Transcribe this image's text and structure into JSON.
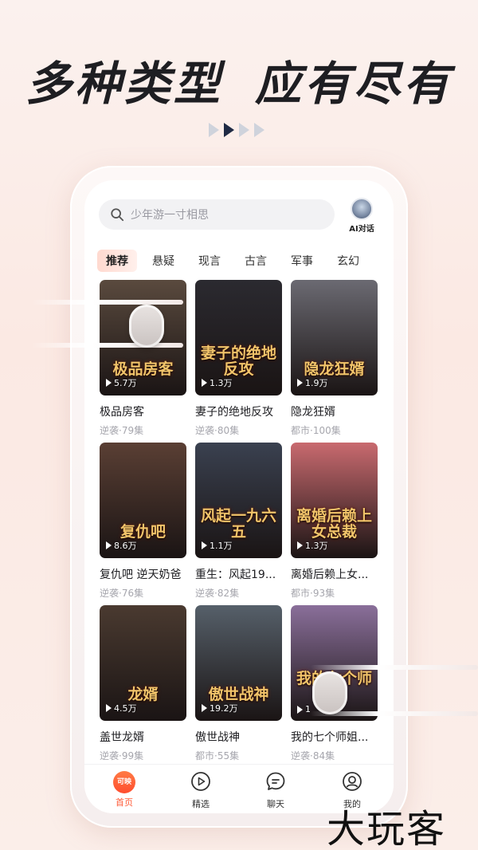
{
  "headline": {
    "left": "多种类型",
    "right": "应有尽有"
  },
  "search": {
    "placeholder": "少年游一寸相思"
  },
  "ai_button": {
    "label": "AI对话"
  },
  "tabs": [
    "推荐",
    "悬疑",
    "现言",
    "古言",
    "军事",
    "玄幻"
  ],
  "cards": [
    {
      "name": "极品房客",
      "meta": "逆袭·79集",
      "views": "5.7万",
      "poster_text": "极品房客",
      "bg": "#5a4a3e"
    },
    {
      "name": "妻子的绝地反攻",
      "meta": "逆袭·80集",
      "views": "1.3万",
      "poster_text": "妻子的绝地反攻",
      "bg": "#2b2a30"
    },
    {
      "name": "隐龙狂婿",
      "meta": "都市·100集",
      "views": "1.9万",
      "poster_text": "隐龙狂婿",
      "bg": "#6b6a72"
    },
    {
      "name": "复仇吧 逆天奶爸",
      "meta": "逆袭·76集",
      "views": "8.6万",
      "poster_text": "复仇吧",
      "bg": "#5a3f34"
    },
    {
      "name": "重生：风起19...",
      "meta": "逆袭·82集",
      "views": "1.1万",
      "poster_text": "风起一九六五",
      "bg": "#3a4150"
    },
    {
      "name": "离婚后赖上女...",
      "meta": "都市·93集",
      "views": "1.3万",
      "poster_text": "离婚后赖上女总裁",
      "bg": "#c96a6f"
    },
    {
      "name": "盖世龙婿",
      "meta": "逆袭·99集",
      "views": "4.5万",
      "poster_text": "龙婿",
      "bg": "#4a3a30"
    },
    {
      "name": "傲世战神",
      "meta": "都市·55集",
      "views": "19.2万",
      "poster_text": "傲世战神",
      "bg": "#56606a"
    },
    {
      "name": "我的七个师姐...",
      "meta": "逆袭·84集",
      "views": "1",
      "poster_text": "我的七个师姐",
      "bg": "#8a6f9a"
    }
  ],
  "bottom_nav": [
    {
      "label": "首页",
      "badge": "可映",
      "icon": "home-icon"
    },
    {
      "label": "精选",
      "icon": "play-circle-icon"
    },
    {
      "label": "聊天",
      "icon": "chat-icon"
    },
    {
      "label": "我的",
      "icon": "user-icon"
    }
  ],
  "watermark": "大玩客",
  "colors": {
    "accent": "#ff5a36",
    "text": "#1e1e22",
    "muted": "#a6a6ad"
  }
}
